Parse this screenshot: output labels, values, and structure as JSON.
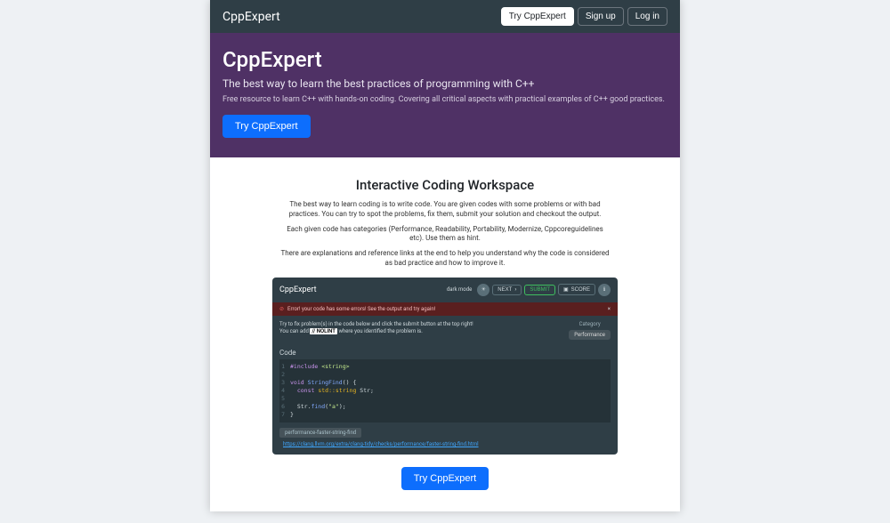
{
  "nav": {
    "brand": "CppExpert",
    "try": "Try CppExpert",
    "signup": "Sign up",
    "login": "Log in"
  },
  "hero": {
    "title": "CppExpert",
    "subtitle": "The best way to learn the best practices of programming with C++",
    "description": "Free resource to learn C++ with hands-on coding. Covering all critical aspects with practical examples of C++ good practices.",
    "cta": "Try CppExpert"
  },
  "workspace": {
    "heading": "Interactive Coding Workspace",
    "para1": "The best way to learn coding is to write code. You are given codes with some problems or with bad practices. You can try to spot the problems, fix them, submit your solution and checkout the output.",
    "para2": "Each given code has categories (Performance, Readability, Portability, Modernize, Cppcoreguidelines etc). Use them as hint.",
    "para3": "There are explanations and reference links at the end to help you understand why the code is considered as bad practice and how to improve it."
  },
  "app": {
    "brand": "CppExpert",
    "darkmode_label": "dark mode",
    "next": "NEXT",
    "submit": "SUBMIT",
    "score": "SCORE",
    "alert": "Error! your code has some errors! See the output and try again!",
    "hint_line1": "Try to fix problem(s) in the code below and click the submit button at the top right!",
    "hint_line2_a": "You can add",
    "hint_nolint": "// NOLINT",
    "hint_line2_b": "where you identified the problem is.",
    "category_label": "Category",
    "category_value": "Performance",
    "code_heading": "Code",
    "code_lines": [
      {
        "n": "1",
        "html": "<span class='kw'>#include</span> <span class='str'>&lt;string&gt;</span>"
      },
      {
        "n": "2",
        "html": ""
      },
      {
        "n": "3",
        "html": "<span class='kw'>void</span> <span class='fn'>StringFind</span>() {"
      },
      {
        "n": "4",
        "html": "&nbsp;&nbsp;<span class='kw'>const</span> <span class='typ'>std::string</span> Str;"
      },
      {
        "n": "5",
        "html": ""
      },
      {
        "n": "6",
        "html": "&nbsp;&nbsp;Str.<span class='fn'>find</span>(<span class='str'>\"a\"</span>);"
      },
      {
        "n": "7",
        "html": "}"
      }
    ],
    "tag": "performance-faster-string-find",
    "ref_link": "https://clang.llvm.org/extra/clang-tidy/checks/performance/faster-string-find.html"
  },
  "bottom_cta": "Try CppExpert"
}
